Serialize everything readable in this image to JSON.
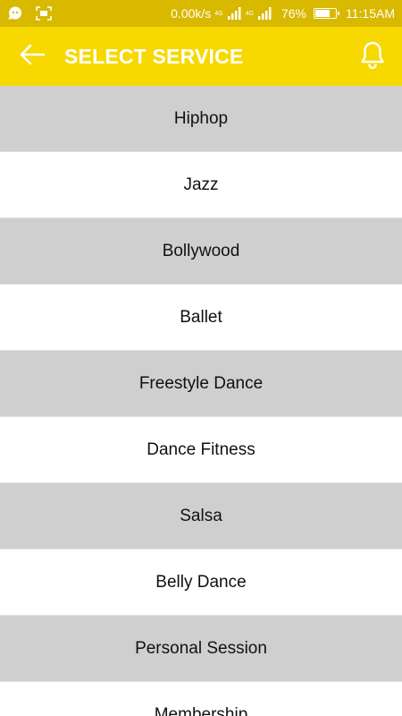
{
  "colors": {
    "status_bar": "#d9b800",
    "app_bar": "#f7d800",
    "row_gray": "#cfcfcf",
    "row_white": "#ffffff",
    "text": "#111111"
  },
  "status_bar": {
    "network_speed": "0.00k/s",
    "net_type_1": "4G",
    "net_type_2": "4G",
    "battery": "76%",
    "battery_level": 0.76,
    "time": "11:15AM",
    "icons": [
      "chat-bubble-icon",
      "screenshot-icon",
      "signal-icon",
      "signal-icon",
      "battery-icon"
    ]
  },
  "app_bar": {
    "title": "SELECT SERVICE",
    "back_icon": "back-arrow-icon",
    "bell_icon": "bell-icon"
  },
  "services": [
    "Hiphop",
    "Jazz",
    "Bollywood",
    "Ballet",
    "Freestyle Dance",
    "Dance Fitness",
    "Salsa",
    "Belly Dance",
    "Personal Session",
    "Membership"
  ]
}
